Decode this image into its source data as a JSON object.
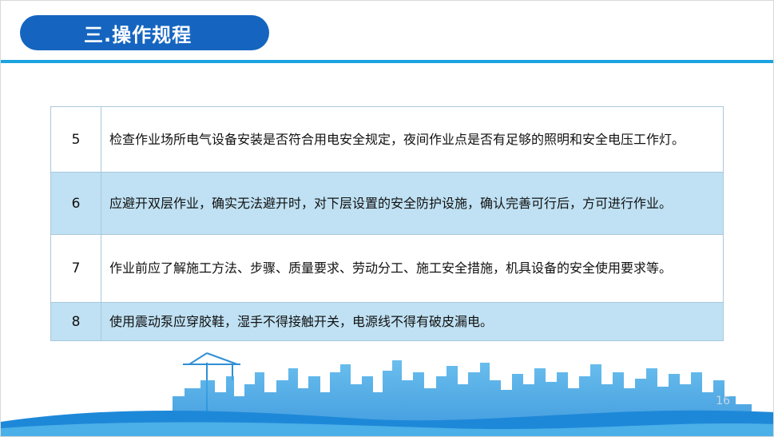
{
  "title": "三.操作规程",
  "rows": [
    {
      "num": "5",
      "text": "检查作业场所电气设备安装是否符合用电安全规定，夜间作业点是否有足够的照明和安全电压工作灯。"
    },
    {
      "num": "6",
      "text": "应避开双层作业，确实无法避开时，对下层设置的安全防护设施，确认完善可行后，方可进行作业。"
    },
    {
      "num": "7",
      "text": "作业前应了解施工方法、步骤、质量要求、劳动分工、施工安全措施，机具设备的安全使用要求等。"
    },
    {
      "num": "8",
      "text": "使用震动泵应穿胶鞋，湿手不得接触开关，电源线不得有破皮漏电。"
    }
  ],
  "page_number": "16",
  "colors": {
    "title_bg": "#1565c0",
    "rule": "#1aa3e0",
    "row_alt": "#bfe1f3",
    "skyline": "#1e88d8"
  }
}
